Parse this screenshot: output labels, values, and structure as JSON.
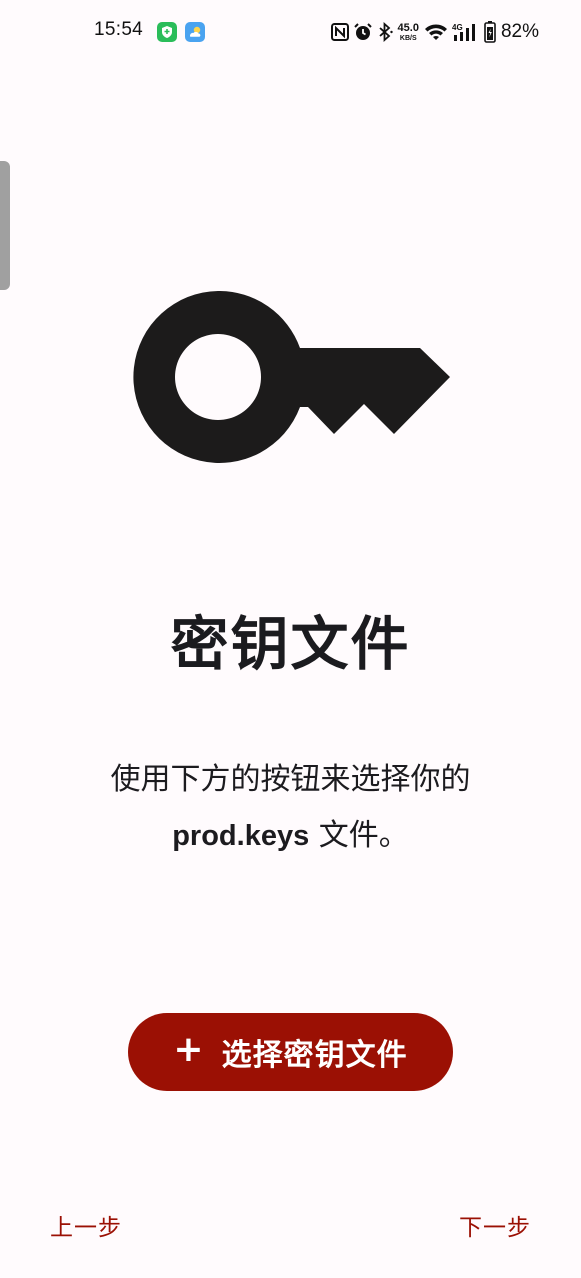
{
  "status_bar": {
    "time": "15:54",
    "net_speed_value": "45.0",
    "net_speed_unit": "KB/S",
    "network_type": "4G",
    "battery_percent": "82%",
    "icons": [
      "shield-app-icon",
      "weather-app-icon",
      "nfc-icon",
      "alarm-icon",
      "bluetooth-icon",
      "wifi-icon",
      "signal-icon",
      "battery-icon"
    ]
  },
  "main": {
    "illustration": "key-icon",
    "title": "密钥文件",
    "description_line1": "使用下方的按钮来选择你的",
    "description_filename": "prod.keys",
    "description_line2_suffix": " 文件。"
  },
  "actions": {
    "select_button_icon": "+",
    "select_button_label": "选择密钥文件",
    "prev_label": "上一步",
    "next_label": "下一步"
  },
  "colors": {
    "accent": "#9b1004",
    "background": "#fffbfd",
    "key": "#1c1b1b"
  }
}
